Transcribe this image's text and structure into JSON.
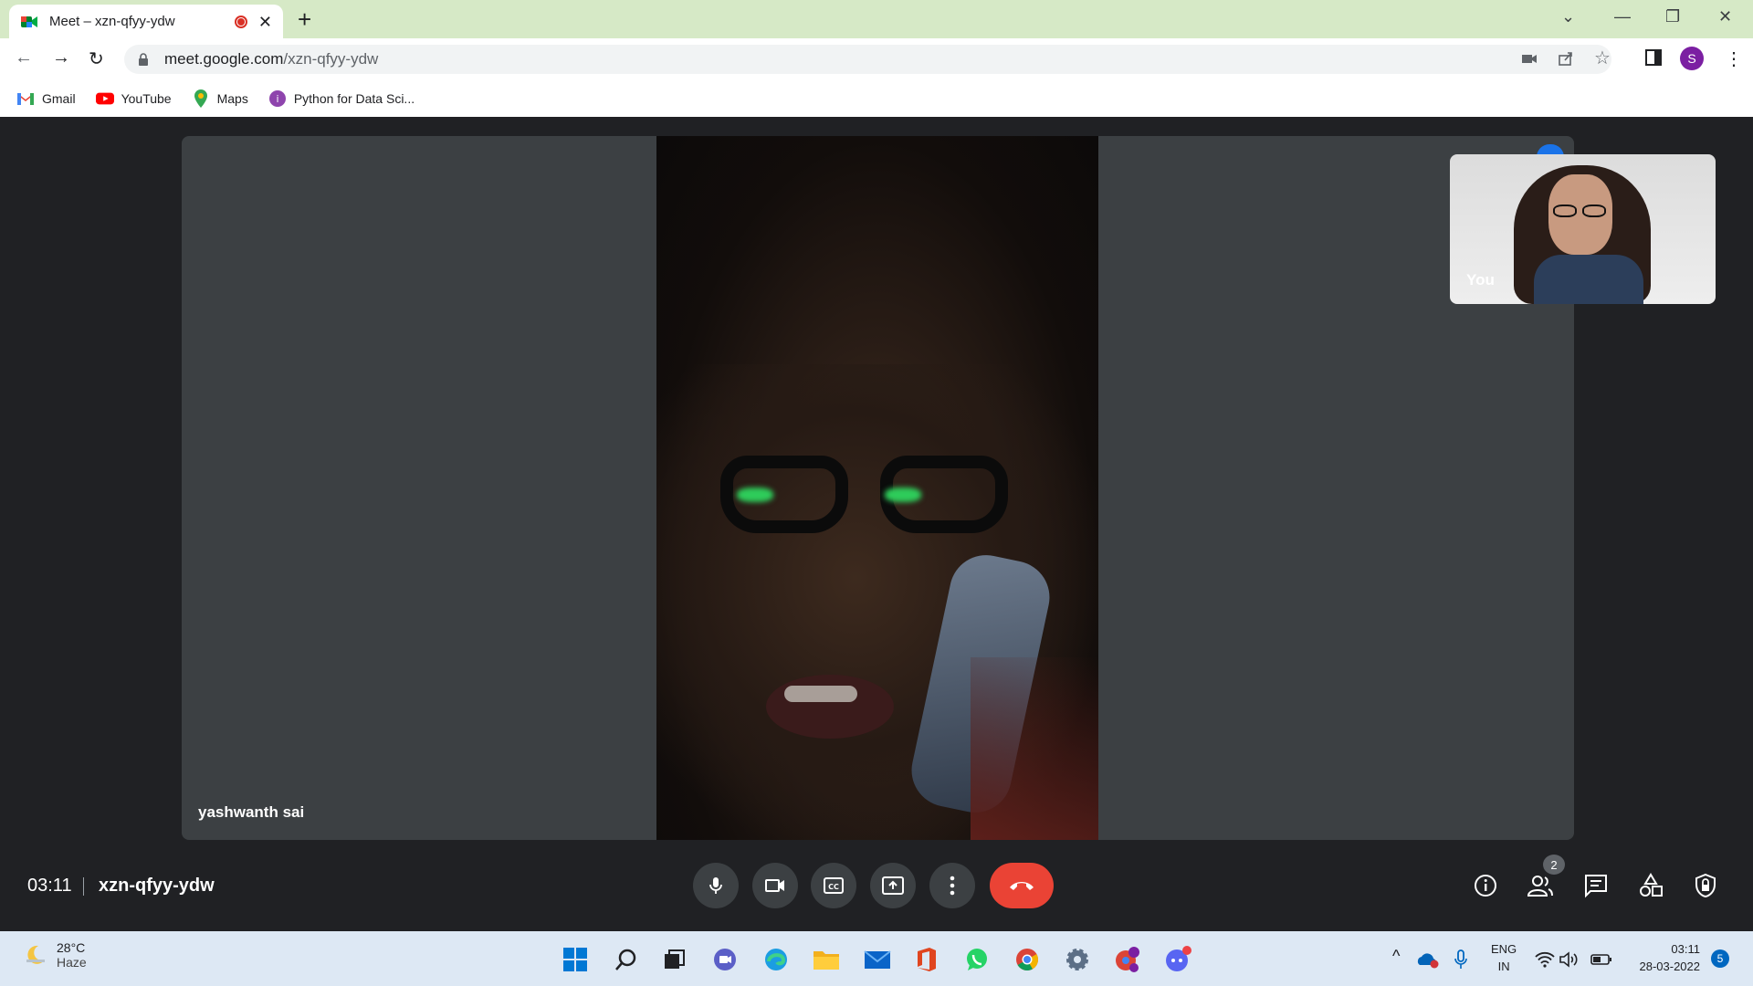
{
  "browser": {
    "tab_title": "Meet – xzn-qfyy-ydw",
    "url_host": "meet.google.com",
    "url_path": "/xzn-qfyy-ydw",
    "profile_initial": "S"
  },
  "bookmarks": [
    {
      "label": "Gmail",
      "icon": "gmail-icon"
    },
    {
      "label": "YouTube",
      "icon": "youtube-icon"
    },
    {
      "label": "Maps",
      "icon": "maps-icon"
    },
    {
      "label": "Python for Data Sci...",
      "icon": "course-icon"
    }
  ],
  "meet": {
    "main_participant": "yashwanth sai",
    "self_label": "You",
    "time": "03:11",
    "meeting_code": "xzn-qfyy-ydw",
    "participants_count": "2"
  },
  "taskbar": {
    "weather_temp": "28°C",
    "weather_desc": "Haze",
    "lang_top": "ENG",
    "lang_bottom": "IN",
    "clock_time": "03:11",
    "clock_date": "28-03-2022",
    "notifications": "5"
  },
  "colors": {
    "meet_bg": "#202124",
    "end_call": "#ea4335",
    "tabstrip": "#d6e9c6"
  }
}
